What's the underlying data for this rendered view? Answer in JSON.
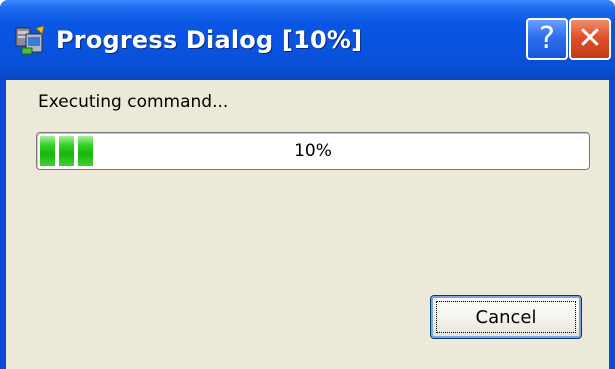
{
  "window": {
    "title": "Progress Dialog [10%]",
    "icons": {
      "app": "app-icon",
      "help": "help-icon",
      "close": "close-icon"
    },
    "help_glyph": "?",
    "close_glyph": "✕"
  },
  "dialog": {
    "status": "Executing command...",
    "progress": {
      "percent_label": "10%",
      "fraction": 0.1
    },
    "cancel_label": "Cancel"
  },
  "colors": {
    "titlebar": "#0853e0",
    "client_bg": "#ece9d8",
    "progress_fill": "#18b40c",
    "close_button": "#e0502a"
  }
}
